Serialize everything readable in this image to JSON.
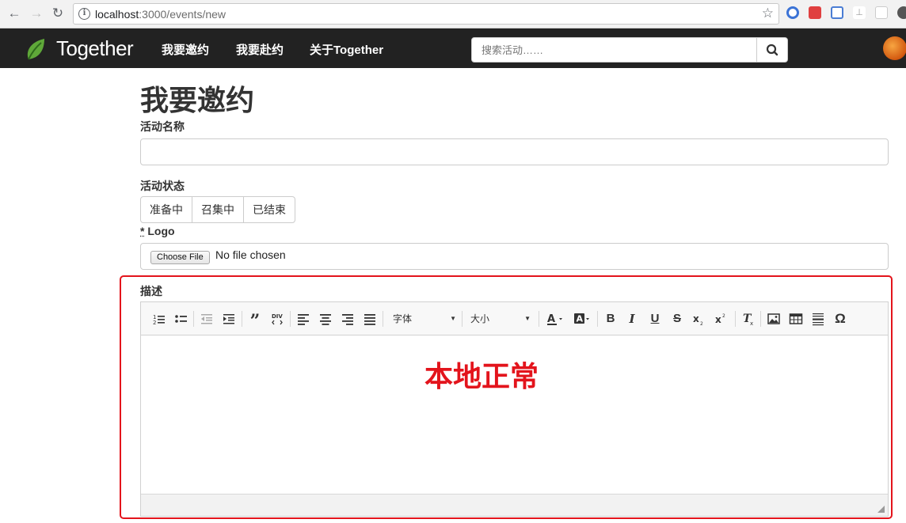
{
  "browser": {
    "url_host": "localhost",
    "url_path": ":3000/events/new"
  },
  "navbar": {
    "brand": "Together",
    "links": [
      "我要邀约",
      "我要赴约",
      "关于Together"
    ],
    "search_placeholder": "搜索活动……"
  },
  "form": {
    "title": "我要邀约",
    "name_label": "活动名称",
    "status_label": "活动状态",
    "status_options": [
      "准备中",
      "召集中",
      "已结束"
    ],
    "logo_required_mark": "*",
    "logo_label": "Logo",
    "choose_file_label": "Choose File",
    "no_file_text": "No file chosen",
    "description_label": "描述"
  },
  "editor": {
    "font_combo": "字体",
    "size_combo": "大小"
  },
  "annotation": {
    "text": "本地正常",
    "color": "#e3141c"
  }
}
